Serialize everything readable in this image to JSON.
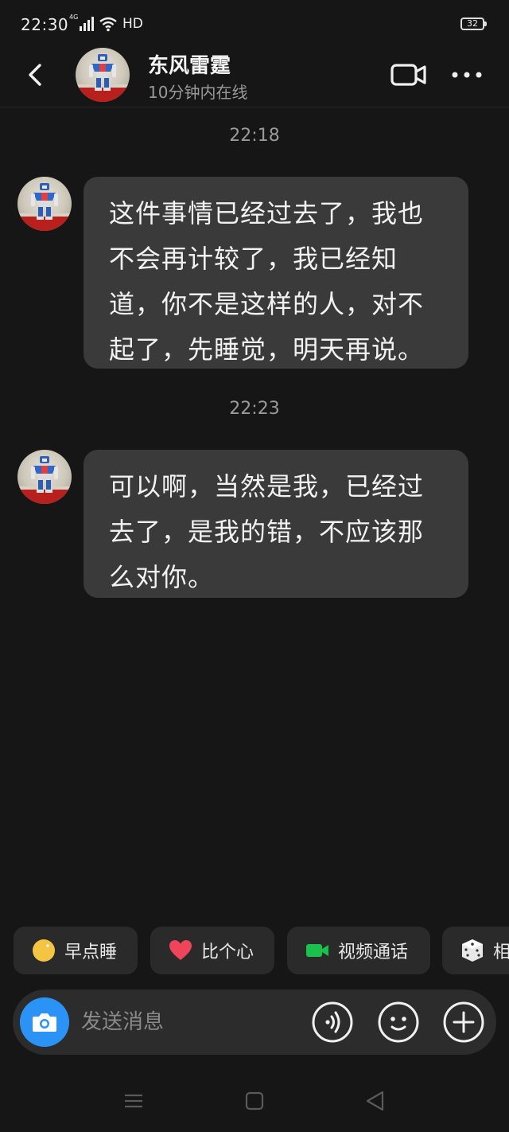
{
  "status_bar": {
    "time": "22:30",
    "network": "4G",
    "hd_label": "HD",
    "battery": "32"
  },
  "header": {
    "contact_name": "东风雷霆",
    "contact_status": "10分钟内在线"
  },
  "messages": [
    {
      "timestamp": "22:18",
      "text": "这件事情已经过去了，我也不会再计较了，我已经知道，你不是这样的人，对不起了，先睡觉，明天再说。"
    },
    {
      "timestamp": "22:23",
      "text": "可以啊，当然是我，已经过去了，是我的错，不应该那么对你。"
    }
  ],
  "quick_actions": [
    {
      "label": "早点睡",
      "icon": "moon-icon"
    },
    {
      "label": "比个心",
      "icon": "heart-icon"
    },
    {
      "label": "视频通话",
      "icon": "video-call-icon"
    },
    {
      "label": "相",
      "icon": "dice-icon"
    }
  ],
  "input": {
    "placeholder": "发送消息"
  },
  "colors": {
    "background": "#161616",
    "bubble": "#3a3a3a",
    "accent_blue": "#2a93f5",
    "heart_red": "#f0445a",
    "video_green": "#19c24a"
  }
}
